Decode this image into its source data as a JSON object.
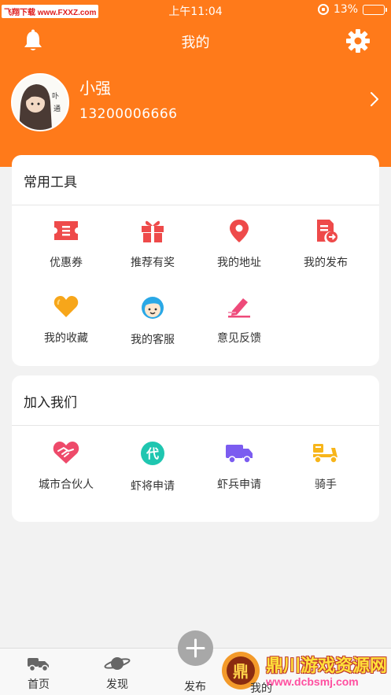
{
  "status_bar": {
    "watermark": "飞翔下载 www.FXXZ.com",
    "time": "上午11:04",
    "battery_percent": "13%",
    "battery_level": 0.13
  },
  "header": {
    "title": "我的",
    "left_icon": "bell-icon",
    "right_icon": "gear-icon"
  },
  "profile": {
    "name": "小强",
    "phone": "13200006666",
    "avatar_text": "卟通"
  },
  "tools": {
    "title": "常用工具",
    "items": [
      {
        "label": "优惠券",
        "icon": "coupon-icon",
        "color": "#ee4a4a"
      },
      {
        "label": "推荐有奖",
        "icon": "gift-icon",
        "color": "#ee4a4a"
      },
      {
        "label": "我的地址",
        "icon": "location-pin-icon",
        "color": "#ee4a4a"
      },
      {
        "label": "我的发布",
        "icon": "publish-doc-icon",
        "color": "#ee4a4a"
      },
      {
        "label": "我的收藏",
        "icon": "heart-icon",
        "color": "#f7a61a"
      },
      {
        "label": "我的客服",
        "icon": "customer-service-icon",
        "color": "#2aa8e6"
      },
      {
        "label": "意见反馈",
        "icon": "feedback-pen-icon",
        "color": "#ee4a7a"
      }
    ]
  },
  "join": {
    "title": "加入我们",
    "items": [
      {
        "label": "城市合伙人",
        "icon": "handshake-heart-icon",
        "color": "#ee4a6a"
      },
      {
        "label": "虾将申请",
        "icon": "dai-badge-icon",
        "color": "#1fc6b0"
      },
      {
        "label": "虾兵申请",
        "icon": "truck-icon",
        "color": "#7b5cf0"
      },
      {
        "label": "骑手",
        "icon": "scooter-icon",
        "color": "#f7b51a"
      }
    ]
  },
  "tabbar": {
    "tabs": [
      {
        "label": "首页",
        "icon": "home-car-icon"
      },
      {
        "label": "发现",
        "icon": "planet-icon"
      },
      {
        "label": "发布",
        "icon": "plus-icon"
      },
      {
        "label": "我的",
        "icon": "user-icon"
      }
    ]
  },
  "watermark_bottom": {
    "title": "鼎川游戏资源网",
    "url": "www.dcbsmj.com"
  },
  "colors": {
    "brand_orange": "#ff7a1a",
    "background": "#f2f2f2"
  }
}
